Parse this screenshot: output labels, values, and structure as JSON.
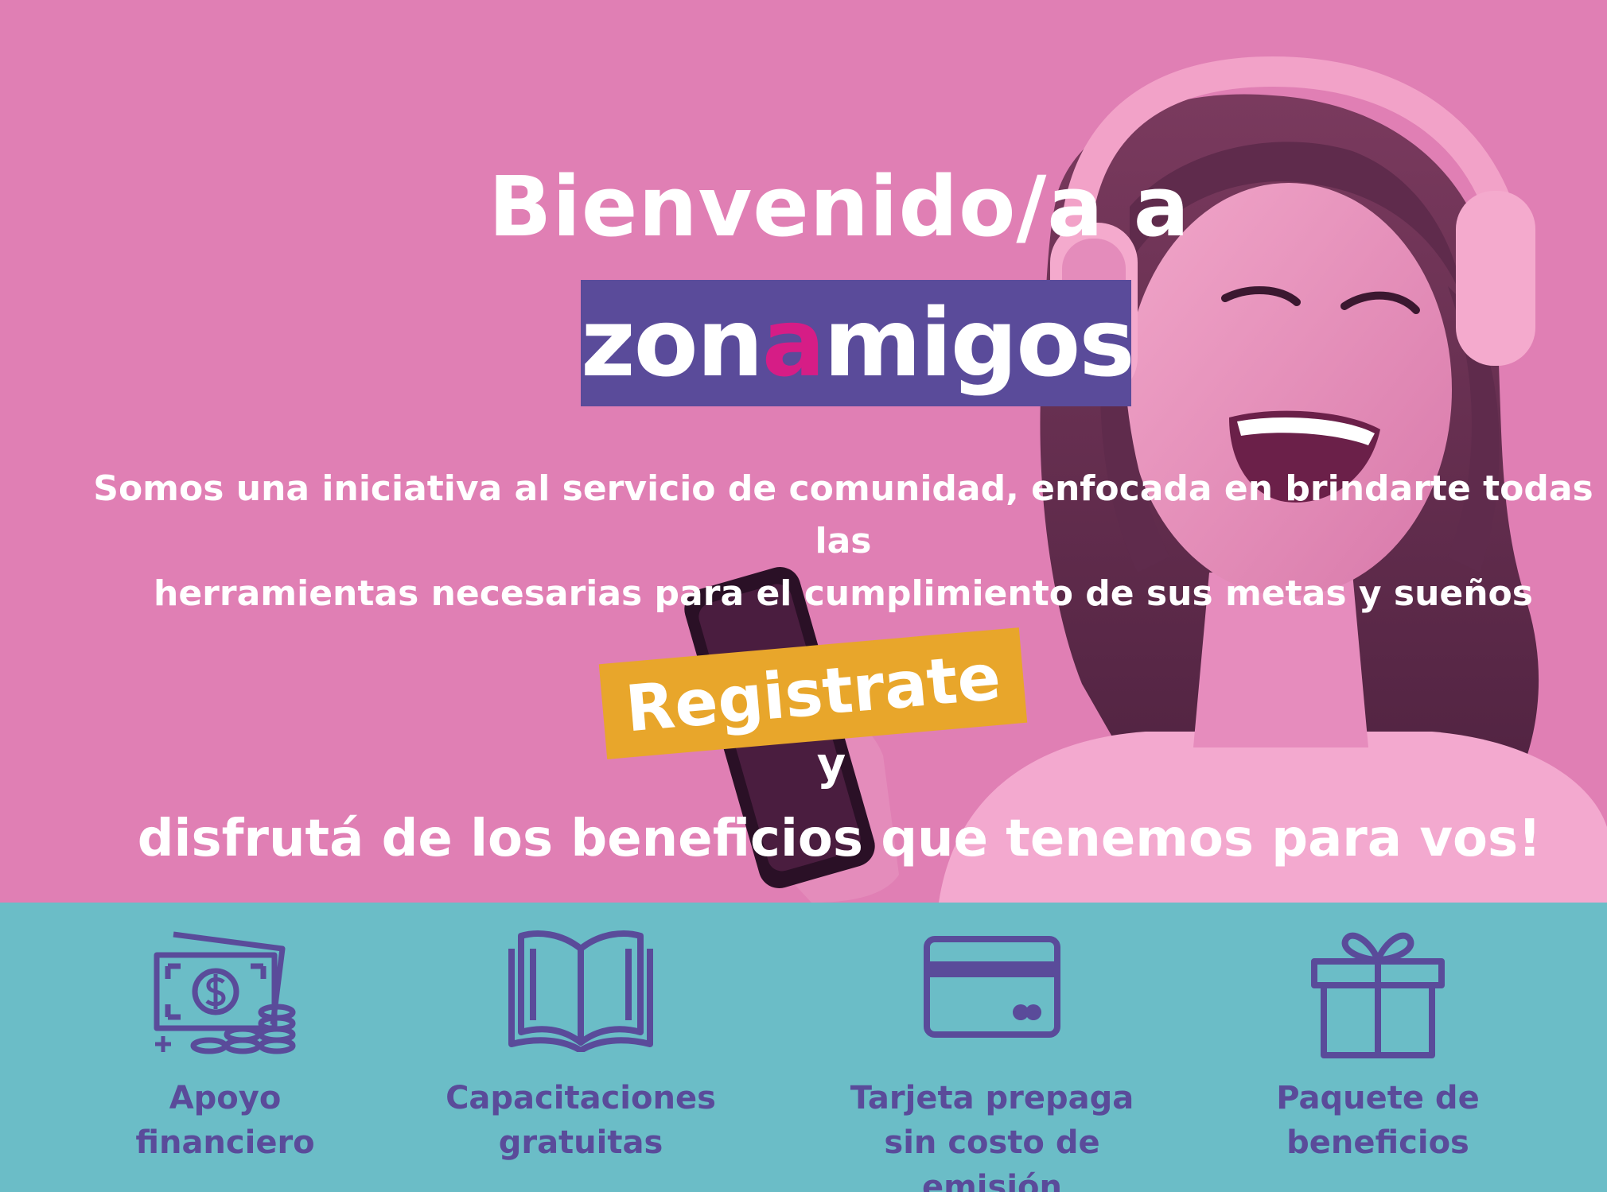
{
  "hero": {
    "headline": "Bienvenido/a a",
    "logo": {
      "part1": "zon",
      "accent": "a",
      "part2": "migos"
    },
    "intro_line1": "Somos una iniciativa al servicio de comunidad, enfocada  en brindarte todas las",
    "intro_line2": "herramientas necesarias para el cumplimiento de sus metas y sueños",
    "cta_label": "Registrate",
    "connector": "y",
    "enjoy": "disfrutá de los beneficios que tenemos para vos!"
  },
  "benefits": [
    {
      "icon": "money-icon",
      "line1": "Apoyo",
      "line2": "financiero"
    },
    {
      "icon": "book-icon",
      "line1": "Capacitaciones",
      "line2": "gratuitas"
    },
    {
      "icon": "credit-card-icon",
      "line1": "Tarjeta prepaga",
      "line2": "sin costo de emisión"
    },
    {
      "icon": "gift-icon",
      "line1": "Paquete de",
      "line2": "beneficios"
    }
  ],
  "colors": {
    "hero_bg": "#e07fb4",
    "logo_bg": "#5a4b9a",
    "logo_accent": "#d61d86",
    "cta_bg": "#e8a62b",
    "benefits_bg": "#6bbdc7",
    "benefits_text": "#5a4b9a"
  }
}
